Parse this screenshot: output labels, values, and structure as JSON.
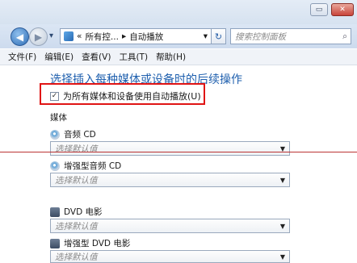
{
  "window": {
    "minimize_glyph": "▭",
    "close_glyph": "✕"
  },
  "nav": {
    "back_glyph": "◀",
    "forward_glyph": "▶",
    "history_glyph": "▾",
    "address_prefix": "«",
    "address_parent": "所有控...",
    "address_separator": "▸",
    "address_current": "自动播放",
    "address_dropdown": "▾",
    "refresh_glyph": "↻",
    "search_placeholder": "搜索控制面板",
    "search_icon": "⌕"
  },
  "menu": {
    "items": [
      "文件(F)",
      "编辑(E)",
      "查看(V)",
      "工具(T)",
      "帮助(H)"
    ]
  },
  "content": {
    "heading": "选择插入每种媒体或设备时的后续操作",
    "autoplay_checkbox": {
      "label": "为所有媒体和设备使用自动播放(U)",
      "checked": true,
      "check_glyph": "✓"
    },
    "section_title": "媒体",
    "media": [
      {
        "label": "音频 CD",
        "value": "选择默认值",
        "icon": "cd-icon"
      },
      {
        "label": "增强型音频 CD",
        "value": "选择默认值",
        "icon": "cd-icon"
      },
      {
        "label": "DVD 电影",
        "value": "选择默认值",
        "icon": "dvd-icon"
      },
      {
        "label": "增强型 DVD 电影",
        "value": "选择默认值",
        "icon": "dvd-icon"
      }
    ],
    "dropdown_arrow": "▼"
  },
  "colors": {
    "heading": "#1e5fae",
    "highlight_box": "#e01414"
  }
}
